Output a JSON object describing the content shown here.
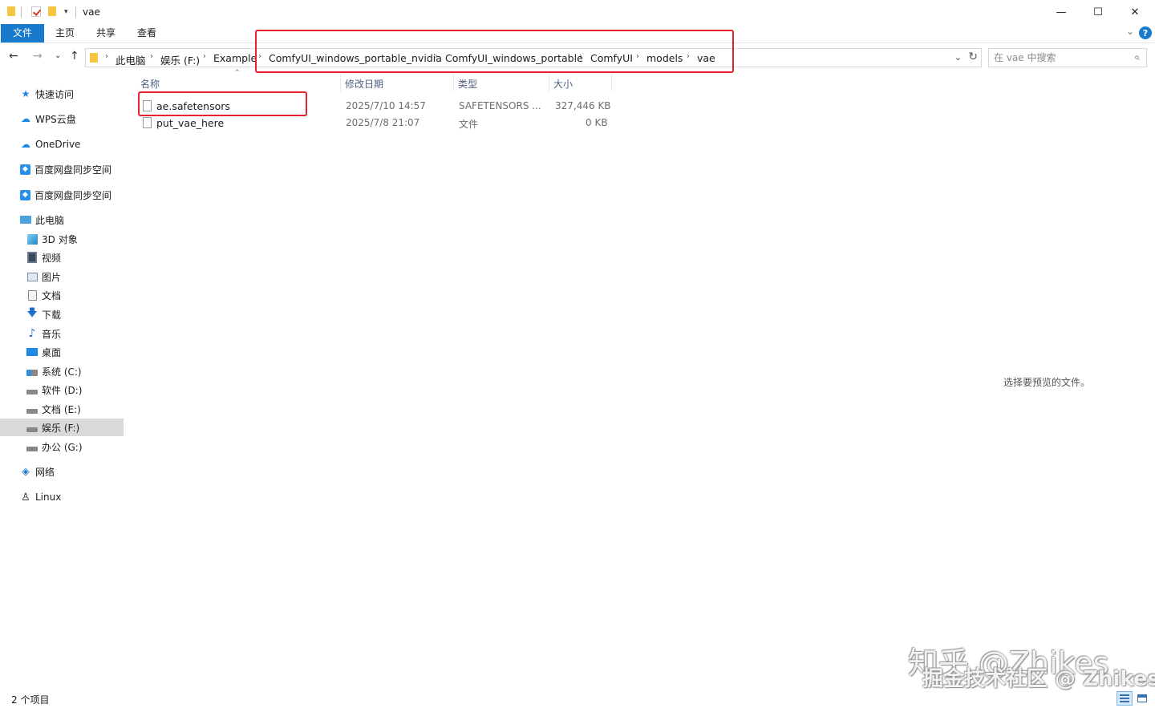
{
  "window": {
    "title": "vae",
    "controls": {
      "minimize": "—",
      "maximize": "☐",
      "close": "✕"
    }
  },
  "ribbon": {
    "tabs": [
      {
        "label": "文件"
      },
      {
        "label": "主页"
      },
      {
        "label": "共享"
      },
      {
        "label": "查看"
      }
    ],
    "help": "?"
  },
  "address": {
    "breadcrumbs": [
      "此电脑",
      "娱乐 (F:)",
      "Example",
      "ComfyUI_windows_portable_nvidia",
      "ComfyUI_windows_portable",
      "ComfyUI",
      "models",
      "vae"
    ],
    "search_placeholder": "在 vae 中搜索"
  },
  "sidebar": {
    "items": [
      {
        "label": "快速访问",
        "icon": "star-icon"
      },
      {
        "label": "WPS云盘",
        "icon": "cloud-icon"
      },
      {
        "label": "OneDrive",
        "icon": "cloud-icon"
      },
      {
        "label": "百度网盘同步空间",
        "icon": "baidu-netdisk-icon"
      },
      {
        "label": "百度网盘同步空间",
        "icon": "baidu-netdisk-icon"
      },
      {
        "label": "此电脑",
        "icon": "computer-icon"
      },
      {
        "label": "3D 对象",
        "icon": "cube-icon"
      },
      {
        "label": "视频",
        "icon": "video-icon"
      },
      {
        "label": "图片",
        "icon": "picture-icon"
      },
      {
        "label": "文档",
        "icon": "document-icon"
      },
      {
        "label": "下载",
        "icon": "download-icon"
      },
      {
        "label": "音乐",
        "icon": "music-icon"
      },
      {
        "label": "桌面",
        "icon": "desktop-icon"
      },
      {
        "label": "系统 (C:)",
        "icon": "system-drive-icon"
      },
      {
        "label": "软件 (D:)",
        "icon": "drive-icon"
      },
      {
        "label": "文档 (E:)",
        "icon": "drive-icon"
      },
      {
        "label": "娱乐 (F:)",
        "icon": "drive-icon",
        "selected": true
      },
      {
        "label": "办公 (G:)",
        "icon": "drive-icon"
      },
      {
        "label": "网络",
        "icon": "network-icon"
      },
      {
        "label": "Linux",
        "icon": "linux-icon"
      }
    ]
  },
  "filelist": {
    "columns": [
      "名称",
      "修改日期",
      "类型",
      "大小"
    ],
    "rows": [
      {
        "name": "ae.safetensors",
        "modified": "2025/7/10 14:57",
        "type": "SAFETENSORS ...",
        "size": "327,446 KB"
      },
      {
        "name": "put_vae_here",
        "modified": "2025/7/8 21:07",
        "type": "文件",
        "size": "0 KB"
      }
    ]
  },
  "preview": {
    "message": "选择要预览的文件。"
  },
  "status": {
    "count": "2 个项目"
  },
  "watermark": {
    "line1": "知乎 @Zhikes",
    "line2": "掘金技术社区 @ Zhikes"
  },
  "colors": {
    "accent": "#1979ca",
    "highlight": "#e5202f",
    "selected_bg": "#d9d9d9"
  }
}
